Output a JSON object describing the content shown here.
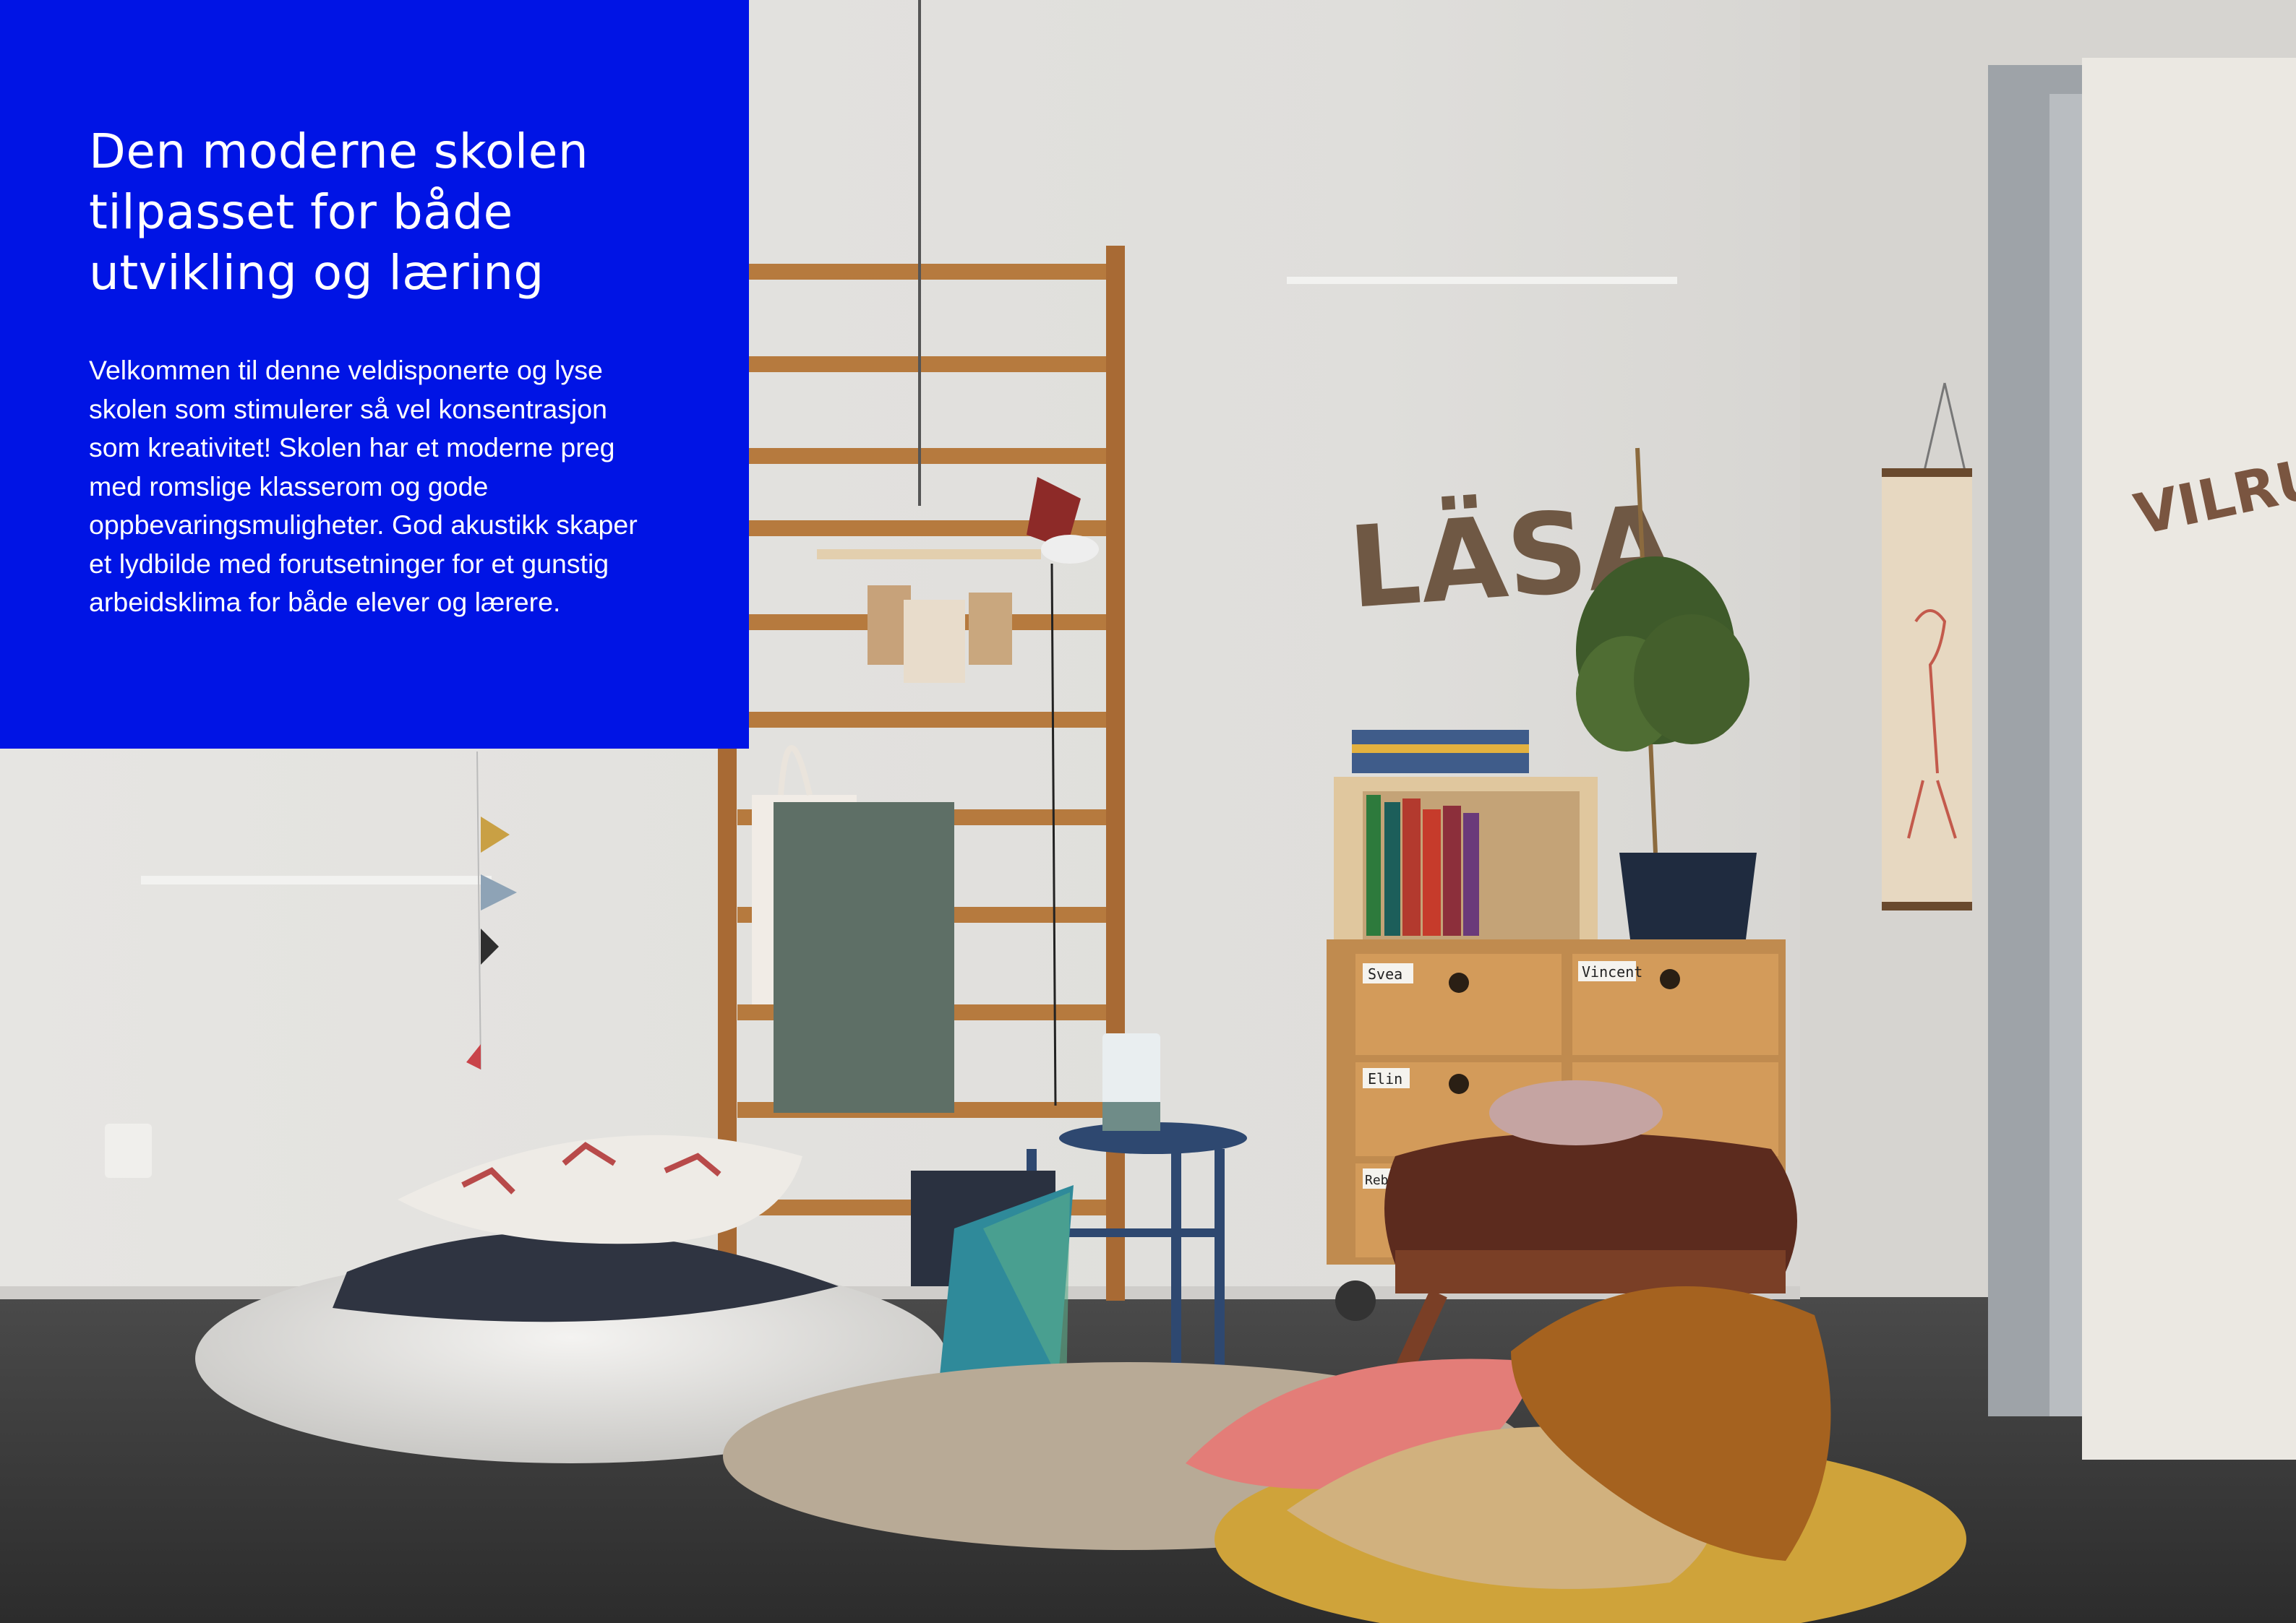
{
  "intro": {
    "title": "Den moderne skolen tilpasset for både utvikling og læring",
    "body": "Velkommen til denne veldisponerte og lyse skolen som stimulerer så vel konsentrasjon som kreativitet! Skolen har et moderne preg med romslige klasserom og gode oppbevaringsmuligheter. God akustikk skaper et lydbilde med forutsetninger for et gunstig arbeidsklima for både elever og lærere.",
    "panel_color": "#0014e5"
  },
  "photo": {
    "wall_letters": "LÄSA",
    "door_sign": "VILRUM",
    "drawer_labels": [
      "Svea",
      "Vincent",
      "Elin",
      "Rebecka"
    ]
  }
}
